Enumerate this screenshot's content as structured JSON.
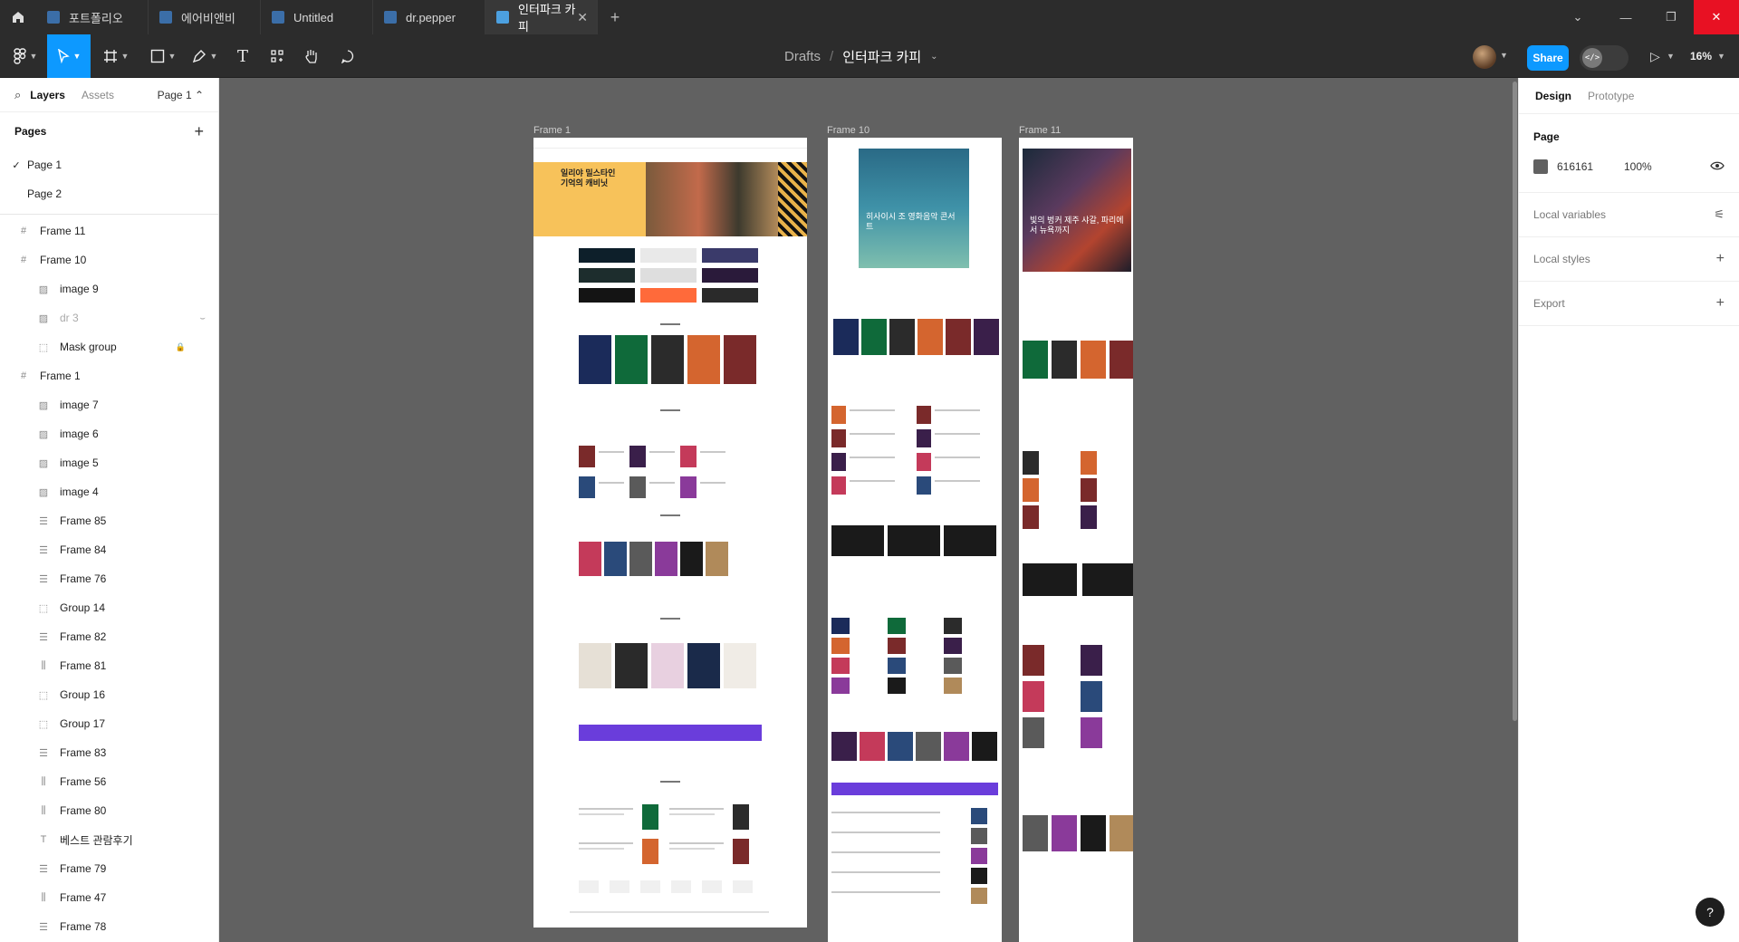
{
  "tabs": [
    {
      "label": "포트폴리오"
    },
    {
      "label": "에어비앤비"
    },
    {
      "label": "Untitled"
    },
    {
      "label": "dr.pepper"
    },
    {
      "label": "인터파크 카피",
      "active": true
    }
  ],
  "breadcrumb": {
    "drafts": "Drafts",
    "separator": "/",
    "file": "인터파크 카피"
  },
  "toolbar": {
    "share_label": "Share",
    "zoom": "16%",
    "dev_label": "</>"
  },
  "left_panel": {
    "tab_layers": "Layers",
    "tab_assets": "Assets",
    "page_selector": "Page 1 ⌃",
    "pages_title": "Pages",
    "pages": [
      {
        "label": "Page 1",
        "checked": true
      },
      {
        "label": "Page 2",
        "checked": false
      }
    ],
    "layers": [
      {
        "label": "Frame 11",
        "type": "frame",
        "level": 0
      },
      {
        "label": "Frame 10",
        "type": "frame",
        "level": 0
      },
      {
        "label": "image 9",
        "type": "image",
        "level": 1
      },
      {
        "label": "dr 3",
        "type": "image",
        "level": 1,
        "hidden": true
      },
      {
        "label": "Mask group",
        "type": "group",
        "level": 1,
        "locked": true
      },
      {
        "label": "Frame 1",
        "type": "frame",
        "level": 0
      },
      {
        "label": "image 7",
        "type": "image",
        "level": 1
      },
      {
        "label": "image 6",
        "type": "image",
        "level": 1
      },
      {
        "label": "image 5",
        "type": "image",
        "level": 1
      },
      {
        "label": "image 4",
        "type": "image",
        "level": 1
      },
      {
        "label": "Frame 85",
        "type": "autolayout-v",
        "level": 1
      },
      {
        "label": "Frame 84",
        "type": "autolayout-v",
        "level": 1
      },
      {
        "label": "Frame 76",
        "type": "autolayout-v",
        "level": 1
      },
      {
        "label": "Group 14",
        "type": "group",
        "level": 1
      },
      {
        "label": "Frame 82",
        "type": "autolayout-v",
        "level": 1
      },
      {
        "label": "Frame 81",
        "type": "autolayout-h",
        "level": 1
      },
      {
        "label": "Group 16",
        "type": "group",
        "level": 1
      },
      {
        "label": "Group 17",
        "type": "group",
        "level": 1
      },
      {
        "label": "Frame 83",
        "type": "autolayout-v",
        "level": 1
      },
      {
        "label": "Frame 56",
        "type": "autolayout-h",
        "level": 1
      },
      {
        "label": "Frame 80",
        "type": "autolayout-h",
        "level": 1
      },
      {
        "label": "베스트 관람후기",
        "type": "text",
        "level": 1
      },
      {
        "label": "Frame 79",
        "type": "autolayout-v",
        "level": 1
      },
      {
        "label": "Frame 47",
        "type": "autolayout-h",
        "level": 1
      },
      {
        "label": "Frame 78",
        "type": "autolayout-v",
        "level": 1
      }
    ]
  },
  "canvas": {
    "background": "#616161",
    "frames": [
      {
        "label": "Frame 1"
      },
      {
        "label": "Frame 10"
      },
      {
        "label": "Frame 11"
      }
    ],
    "frame1_banner_title": "일리야 밀스타인 기억의 캐비닛",
    "frame10_banner_title": "히사이시 조 영화음악 콘서트",
    "frame11_banner_title": "빛의 벙커 제주 샤갈, 파리에서 뉴욕까지"
  },
  "right_panel": {
    "tab_design": "Design",
    "tab_prototype": "Prototype",
    "page_title": "Page",
    "page_color_hex": "616161",
    "page_opacity": "100%",
    "local_variables": "Local variables",
    "local_styles": "Local styles",
    "export": "Export"
  },
  "help_label": "?"
}
